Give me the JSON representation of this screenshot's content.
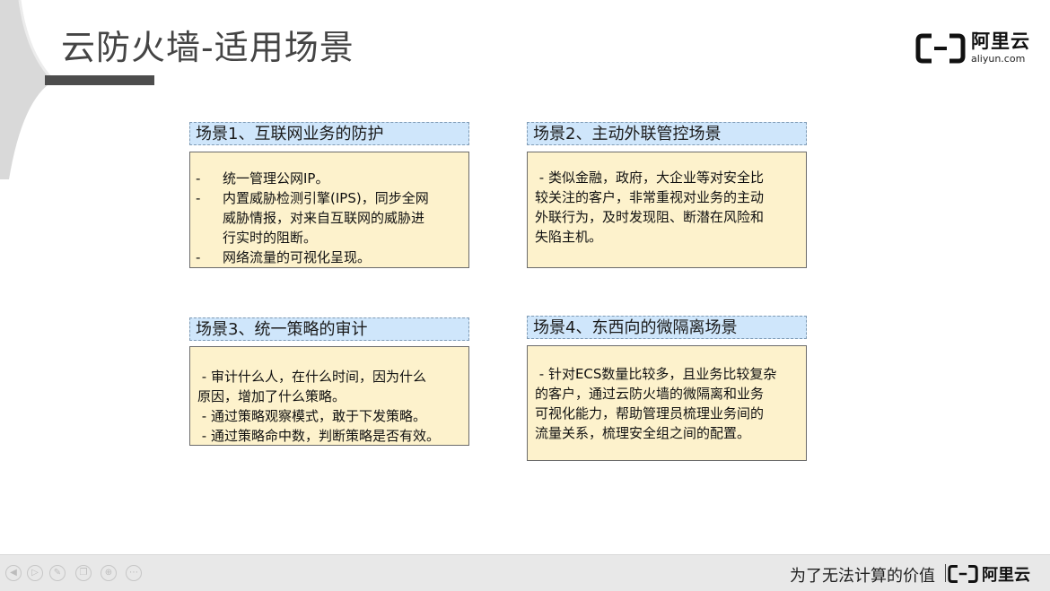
{
  "slide": {
    "title": "云防火墙-适用场景"
  },
  "brand": {
    "name_cn": "阿里云",
    "domain": "aliyun.com",
    "mark_glyph": "–"
  },
  "scenarios": [
    {
      "header": "场景1、互联网业务的防护",
      "bullets": [
        "统一管理公网IP。",
        "内置威胁检测引擎(IPS)，同步全网威胁情报，对来自互联网的威胁进行实时的阻断。",
        "网络流量的可视化呈现。"
      ],
      "lines": [
        {
          "dash": "-",
          "text": "统一管理公网IP。"
        },
        {
          "dash": "-",
          "text": "内置威胁检测引擎(IPS)，同步全网"
        },
        {
          "dash": "",
          "text": "威胁情报，对来自互联网的威胁进"
        },
        {
          "dash": "",
          "text": "行实时的阻断。"
        },
        {
          "dash": "-",
          "text": "网络流量的可视化呈现。"
        }
      ]
    },
    {
      "header": "场景2、主动外联管控场景",
      "lines": [
        " - 类似金融，政府，大企业等对安全比",
        "较关注的客户，非常重视对业务的主动",
        "外联行为，及时发现阻、断潜在风险和",
        "失陷主机。"
      ]
    },
    {
      "header": "场景3、统一策略的审计",
      "lines": [
        " - 审计什么人，在什么时间，因为什么",
        "原因，增加了什么策略。",
        " - 通过策略观察模式，敢于下发策略。",
        " - 通过策略命中数，判断策略是否有效。"
      ]
    },
    {
      "header": "场景4、东西向的微隔离场景",
      "lines": [
        " - 针对ECS数量比较多，且业务比较复杂",
        "的客户，通过云防火墙的微隔离和业务",
        "可视化能力，帮助管理员梳理业务间的",
        "流量关系，梳理安全组之间的配置。"
      ]
    }
  ],
  "footer": {
    "slogan": "为了无法计算的价值",
    "separator": "|",
    "brand": "阿里云",
    "controls": [
      "prev-icon",
      "play-icon",
      "pen-icon",
      "copy-icon",
      "zoom-icon",
      "more-icon"
    ]
  },
  "colors": {
    "header_bg": "#cfe6fb",
    "body_bg": "#fdf2cc",
    "title": "#444444",
    "footer_bg": "#e8e8e8"
  }
}
